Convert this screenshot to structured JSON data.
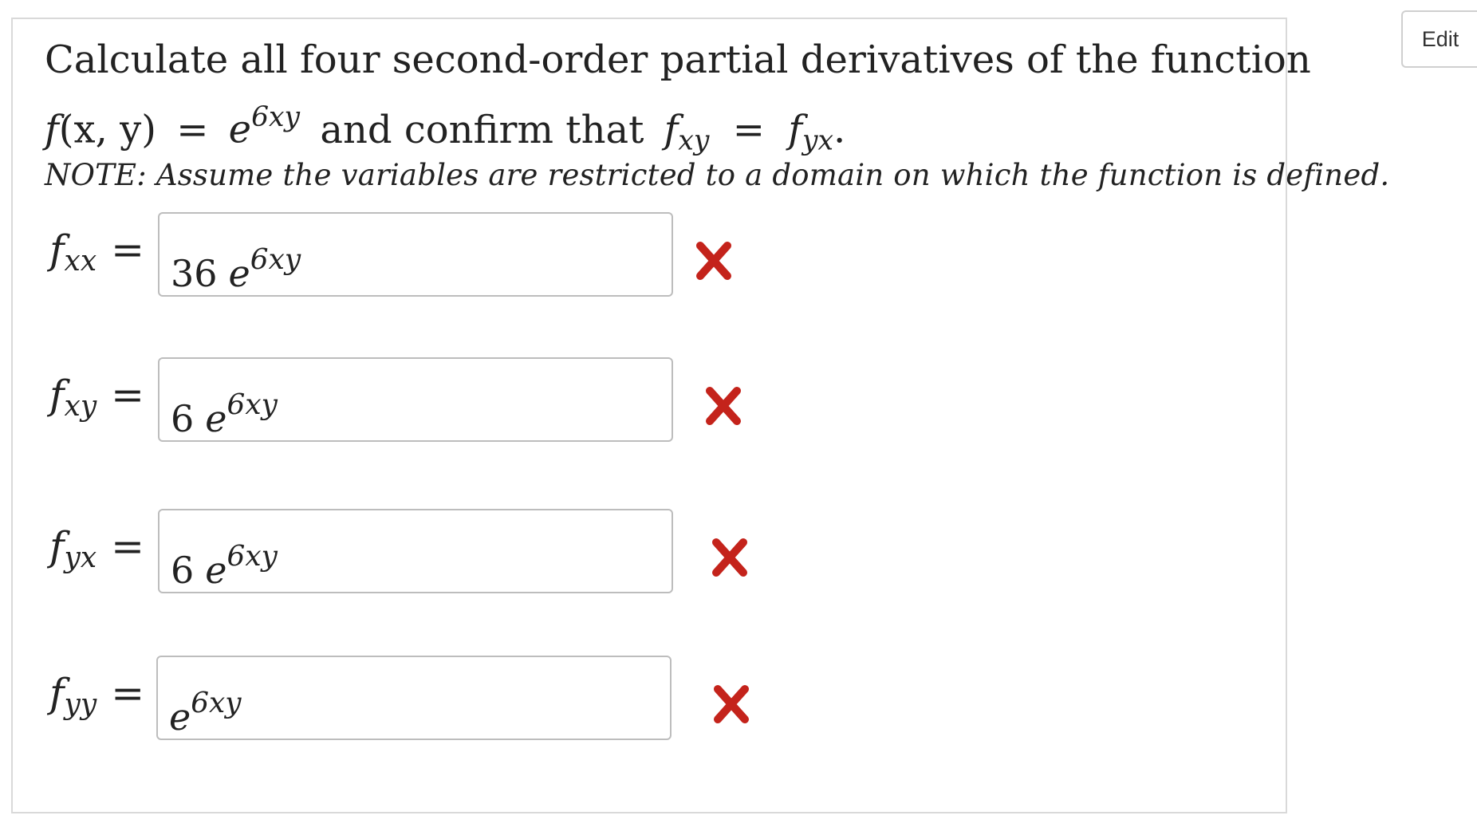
{
  "edit_button_label": "Edit",
  "question": {
    "line1": "Calculate all four second-order partial derivatives of the function",
    "f_name": "f",
    "f_args": "(x, y)",
    "equals": "=",
    "base": "e",
    "exponent": "6xy",
    "and_confirm": "and confirm that",
    "lhs_f": "f",
    "lhs_sub": "xy",
    "rhs_f": "f",
    "rhs_sub": "yx",
    "period": ".",
    "note": "NOTE: Assume the variables are restricted to a domain on which the function is defined."
  },
  "rows": [
    {
      "f": "f",
      "sub": "xx",
      "equals": "=",
      "coef": "36",
      "base": "e",
      "exponent": "6xy",
      "status": "incorrect"
    },
    {
      "f": "f",
      "sub": "xy",
      "equals": "=",
      "coef": "6",
      "base": "e",
      "exponent": "6xy",
      "status": "incorrect"
    },
    {
      "f": "f",
      "sub": "yx",
      "equals": "=",
      "coef": "6",
      "base": "e",
      "exponent": "6xy",
      "status": "incorrect"
    },
    {
      "f": "f",
      "sub": "yy",
      "equals": "=",
      "coef": "",
      "base": "e",
      "exponent": "6xy",
      "status": "incorrect"
    }
  ],
  "colors": {
    "wrong_mark": "#c4231b",
    "panel_border": "#d9d9d9",
    "input_border": "#bdbdbd"
  },
  "icons": {
    "wrong_mark": "cross-icon"
  }
}
